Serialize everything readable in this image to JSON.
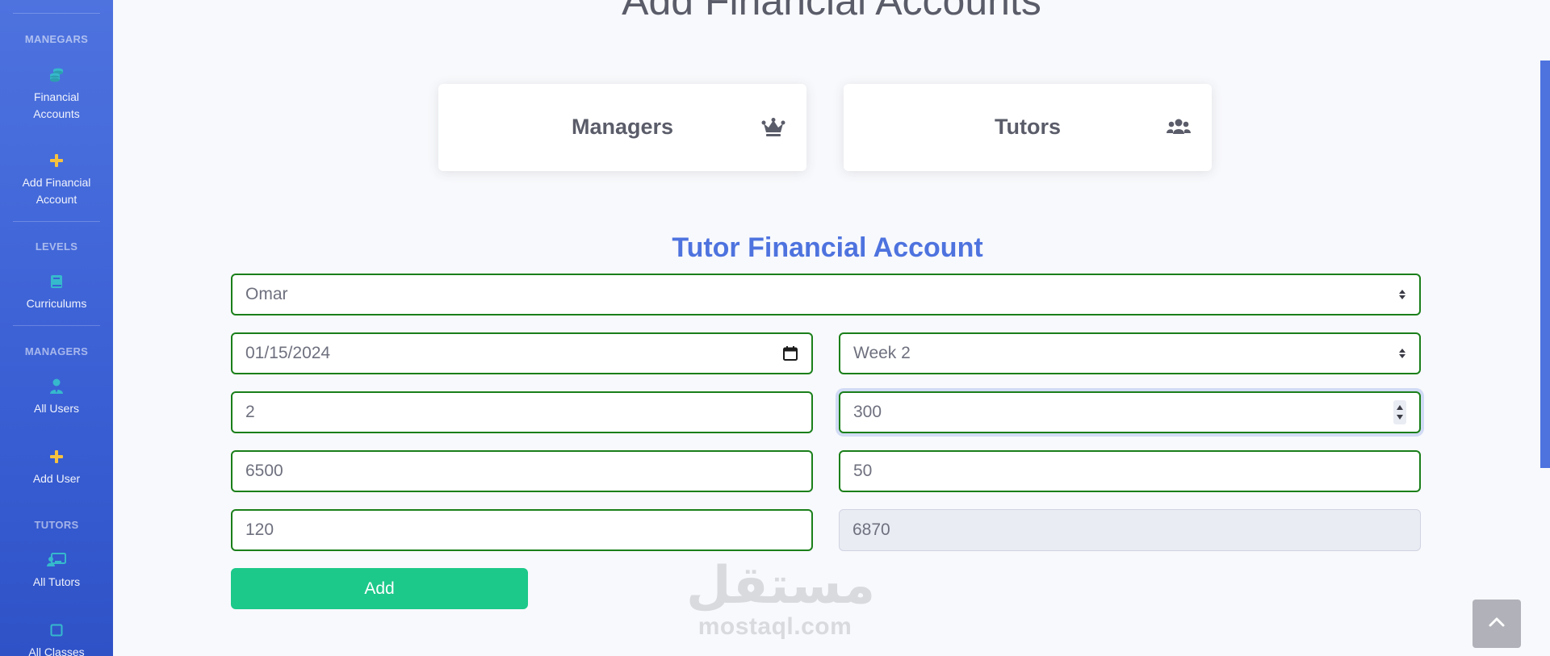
{
  "sidebar": {
    "heading_manegars": "MANEGARS",
    "financial_accounts": "Financial Accounts",
    "add_financial_account": "Add Financial Account",
    "heading_levels": "LEVELS",
    "curriculums": "Curriculums",
    "heading_managers": "MANAGERS",
    "all_users": "All Users",
    "add_user": "Add User",
    "heading_tutors": "TUTORS",
    "all_tutors": "All Tutors",
    "all_classes": "All Classes"
  },
  "page": {
    "title": "Add Financial Accounts"
  },
  "cards": {
    "managers": "Managers",
    "tutors": "Tutors"
  },
  "form": {
    "section_title": "Tutor Financial Account",
    "tutor_select": "Omar",
    "date": "01/15/2024",
    "week_select": "Week 2",
    "field_count": "2",
    "field_rate": "300",
    "field_base": "6500",
    "field_bonus": "50",
    "field_extra": "120",
    "field_total": "6870",
    "add_button": "Add"
  },
  "watermark": {
    "arabic": "مستقل",
    "latin": "mostaql.com"
  },
  "colors": {
    "sidebar": "#4e73df",
    "field_border": "#1a7f1a",
    "add_button": "#1cc88a",
    "section_title": "#4e73df",
    "accent_icon": "#f6c23e",
    "teal_icon": "#36b9cc"
  }
}
